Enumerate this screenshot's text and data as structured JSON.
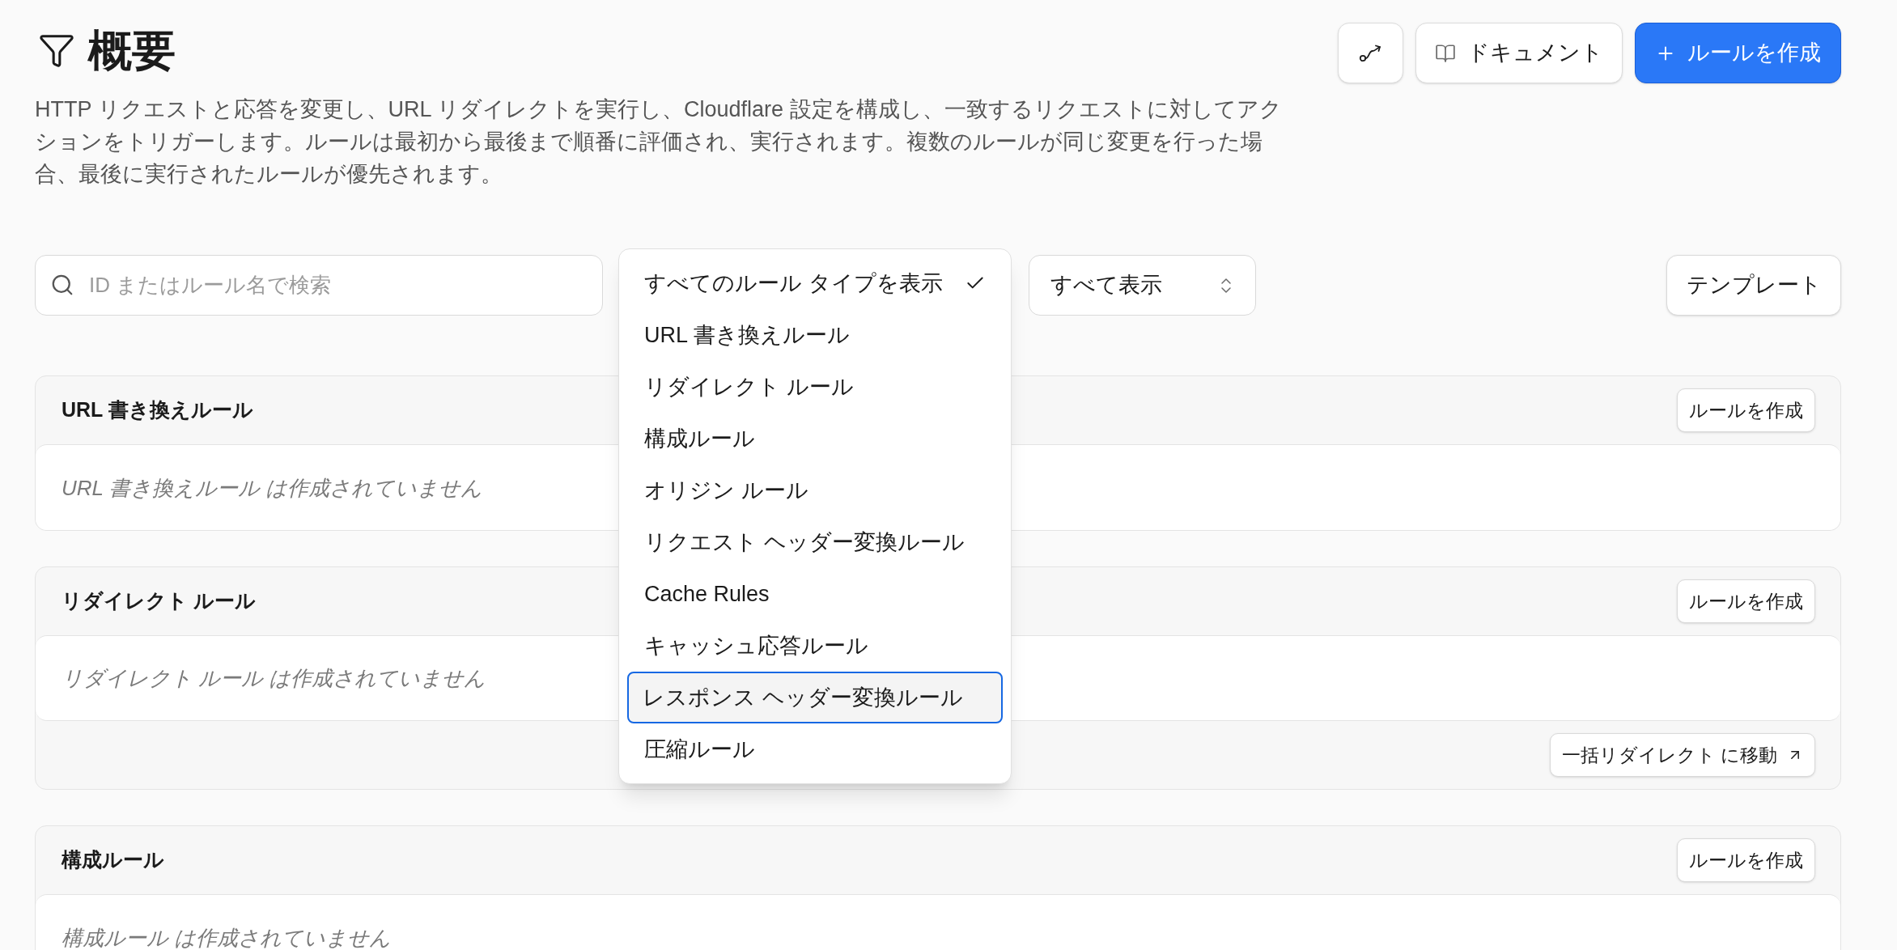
{
  "header": {
    "title": "概要",
    "description": "HTTP リクエストと応答を変更し、URL リダイレクトを実行し、Cloudflare 設定を構成し、一致するリクエストに対してアクションをトリガーします。ルールは最初から最後まで順番に評価され、実行されます。複数のルールが同じ変更を行った場合、最後に実行されたルールが優先されます。",
    "actions": [
      {
        "kind": "icon"
      },
      {
        "kind": "secondary",
        "label": "ドキュメント"
      },
      {
        "kind": "primary",
        "label": "ルールを作成"
      }
    ]
  },
  "toolbar": {
    "search": {
      "placeholder": "ID またはルール名で検索"
    },
    "type_filter": {
      "options": [
        {
          "label": "すべてのルール タイプを表示",
          "selected": true,
          "focused": false
        },
        {
          "label": "URL 書き換えルール",
          "selected": false,
          "focused": false
        },
        {
          "label": "リダイレクト ルール",
          "selected": false,
          "focused": false
        },
        {
          "label": "構成ルール",
          "selected": false,
          "focused": false
        },
        {
          "label": "オリジン ルール",
          "selected": false,
          "focused": false
        },
        {
          "label": "リクエスト ヘッダー変換ルール",
          "selected": false,
          "focused": false
        },
        {
          "label": "Cache Rules",
          "selected": false,
          "focused": false
        },
        {
          "label": "キャッシュ応答ルール",
          "selected": false,
          "focused": false
        },
        {
          "label": "レスポンス ヘッダー変換ルール",
          "selected": false,
          "focused": true
        },
        {
          "label": "圧縮ルール",
          "selected": false,
          "focused": false
        }
      ]
    },
    "status_filter": {
      "value": "すべて表示"
    },
    "template_button": {
      "label": "テンプレート"
    }
  },
  "sections": [
    {
      "title": "URL 書き換えルール",
      "create_label": "ルールを作成",
      "empty_text": "URL 書き換えルール は作成されていません"
    },
    {
      "title": "リダイレクト ルール",
      "create_label": "ルールを作成",
      "empty_text": "リダイレクト ルール は作成されていません",
      "footer_link": "一括リダイレクト に移動"
    },
    {
      "title": "構成ルール",
      "create_label": "ルールを作成",
      "empty_text": "構成ルール は作成されていません"
    }
  ]
}
